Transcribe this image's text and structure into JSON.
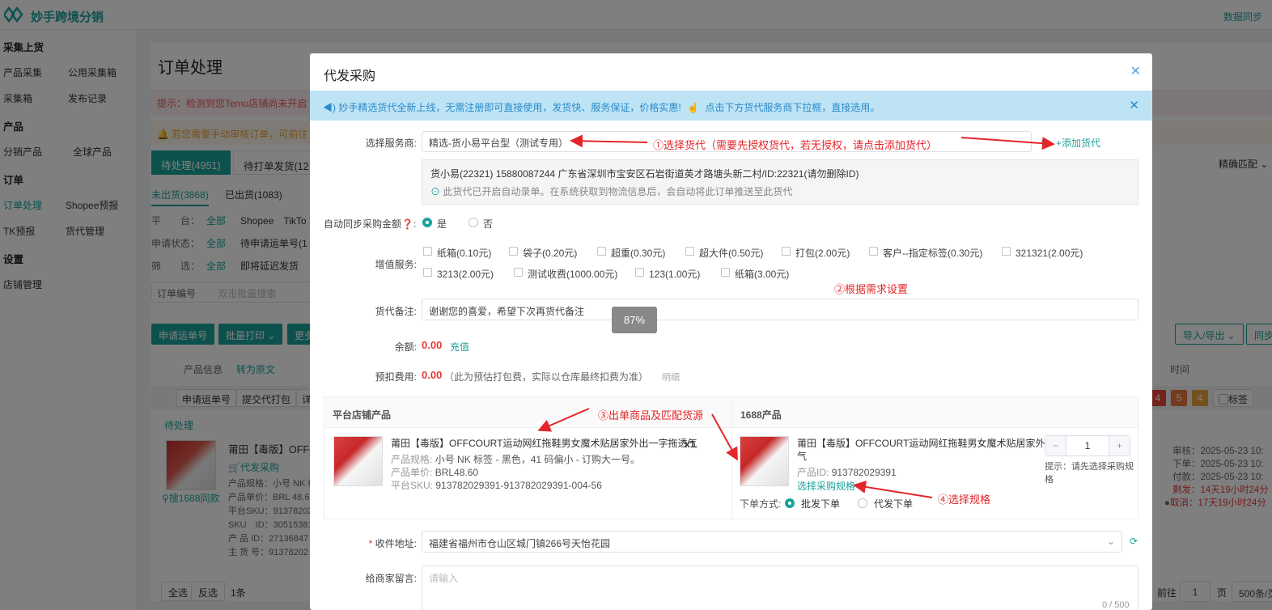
{
  "app": {
    "brand": "妙手跨境分销",
    "sync_label": "数据同步"
  },
  "sidebar": {
    "sections": [
      {
        "title": "采集上货",
        "items": [
          "产品采集",
          "公用采集箱",
          "采集箱",
          "发布记录"
        ]
      },
      {
        "title": "产品",
        "items": [
          "分销产品",
          "全球产品"
        ]
      },
      {
        "title": "订单",
        "items": [
          "订单处理",
          "Shopee预报",
          "TK预报",
          "货代管理"
        ]
      },
      {
        "title": "设置",
        "items": [
          "店铺管理"
        ]
      }
    ],
    "active": "订单处理"
  },
  "background": {
    "title": "订单处理",
    "tip1": "提示：检测到您Temu店铺尚未开启",
    "tip2": "若您需要手动审核订单，可前往",
    "tabs": [
      "待处理(4951)",
      "待打单发货(12"
    ],
    "subtabs": [
      "未出货(3868)",
      "已出货(1083)"
    ],
    "filters": [
      {
        "label": "平　　台：",
        "all": "全部",
        "opts": "Shopee　TikTo"
      },
      {
        "label": "申请状态：",
        "all": "全部",
        "opts": "待申请运单号(1"
      },
      {
        "label": "筛　　选：",
        "all": "全部",
        "opts": "即将延迟发货"
      }
    ],
    "order_no_label": "订单编号",
    "order_no_placeholder": "双击批量搜索",
    "buttons": [
      "申请运单号",
      "批量打印",
      "更多"
    ],
    "right_buttons": [
      "导入/导出",
      "同步"
    ],
    "exact_match": "精确匹配",
    "col_product": "产品信息",
    "col_translate": "转为原文",
    "col_time": "时间",
    "row_buttons": [
      "申请运单号",
      "提交代打包",
      "详"
    ],
    "row_label": "待处理",
    "order_product": "莆田【毒版】OFFC",
    "proxy_purchase": "代发采购",
    "search1688": "搜1688同款",
    "meta_lines": [
      "产品规格：小号 NK 标",
      "产品单价：BRL 48.60",
      "平台SKU：91378202",
      "SKU　ID：30515381",
      "产 品 ID：27136847",
      "主 货 号：91378202"
    ],
    "tags": [
      "4",
      "5",
      "4"
    ],
    "tag_label": "标签",
    "times": [
      "审核：2025-05-23 10:",
      "下单：2025-05-23 10:",
      "付款：2025-05-23 10:",
      "剩发：14天19小时24分",
      "取消：17天19小时24分"
    ],
    "footer": {
      "all": "全选",
      "invert": "反选",
      "count": "1条",
      "goto": "前往",
      "page": "1",
      "page_unit": "页",
      "page_size": "500条/页"
    }
  },
  "modal": {
    "title": "代发采购",
    "banner": "妙手精选货代全新上线，无需注册即可直接使用，发货快、服务保证，价格实惠!",
    "banner_link": "点击下方货代服务商下拉框，直接选用。",
    "service_label": "选择服务商:",
    "service_value": "精选-货小易平台型（测试专用）",
    "add_forwarder": "+添加货代",
    "info_line1": "货小易(22321) 15880087244 广东省深圳市宝安区石岩街道英才路塘头新二村/ID:22321(请勿删除ID)",
    "info_line2": "此货代已开启自动录单。在系统获取到物流信息后，会自动将此订单推送至此货代",
    "auto_sync_label": "自动同步采购金额",
    "yes": "是",
    "no": "否",
    "vas_label": "增值服务:",
    "vas_items": [
      "纸箱(0.10元)",
      "袋子(0.20元)",
      "超重(0.30元)",
      "超大件(0.50元)",
      "打包(2.00元)",
      "客户--指定标签(0.30元)",
      "321321(2.00元)",
      "3213(2.00元)",
      "测试收费(1000.00元)",
      "123(1.00元)",
      "纸箱(3.00元)"
    ],
    "remark_label": "货代备注:",
    "remark_value": "谢谢您的喜爱，希望下次再货代备注",
    "balance_label": "余额:",
    "balance_value": "0.00",
    "recharge": "充值",
    "prefee_label": "预扣费用:",
    "prefee_value": "0.00",
    "prefee_note": "（此为预估打包费，实际以仓库最终扣费为准）",
    "detail": "明细",
    "table": {
      "left_header": "平台店铺产品",
      "right_header": "1688产品",
      "left_title": "莆田【毒版】OFFCOURT运动网红拖鞋男女魔术贴居家外出一字拖透气",
      "qty": "x1",
      "left_spec_label": "产品规格:",
      "left_spec": "小号 NK 标签 - 黑色，41 码偏小 - 订购大一号。",
      "left_price_label": "产品单价:",
      "left_price": "BRL48.60",
      "left_sku_label": "平台SKU:",
      "left_sku": "913782029391-913782029391-004-56",
      "right_title_1": "莆田【毒版】OFFCOURT运动网红拖鞋男女魔术贴居家外出一字拖透",
      "right_title_2": "气",
      "right_id_label": "产品ID:",
      "right_id": "913782029391",
      "select_spec": "选择采购规格",
      "order_mode_label": "下单方式:",
      "mode_wholesale": "批发下单",
      "mode_dropship": "代发下单",
      "stepper_value": "1",
      "hint_1": "提示：请先选择采购规",
      "hint_2": "格"
    },
    "address_label": "收件地址:",
    "address_value": "福建省福州市仓山区城门镇266号天怡花园",
    "message_label": "给商家留言:",
    "message_placeholder": "请输入",
    "message_count": "0 / 500"
  },
  "annotations": {
    "a1": "①选择货代（需要先授权货代，若无授权，请点击添加货代）",
    "a2": "②根据需求设置",
    "a3": "③出单商品及匹配货源",
    "a4": "④选择规格"
  },
  "zoom": "87%",
  "colors": {
    "accent": "#1aa39a",
    "danger": "#e4393c",
    "annotation": "#e4262a"
  }
}
